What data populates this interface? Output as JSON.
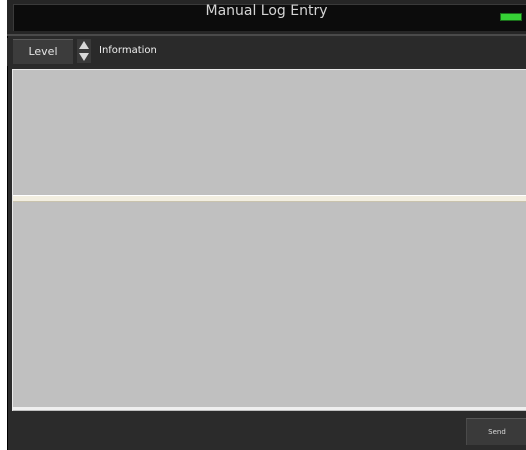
{
  "window": {
    "title": "Manual Log Entry",
    "status_indicator": "green-status-led"
  },
  "level_selector": {
    "label": "Level",
    "value": "Information"
  },
  "log_text": {
    "message_value": "",
    "details_value": ""
  },
  "actions": {
    "send_label": "Send"
  },
  "colors": {
    "background": "#2b2b2b",
    "panel": "#c0c0c0",
    "divider": "#f2eee0",
    "status_led": "#36d236"
  }
}
